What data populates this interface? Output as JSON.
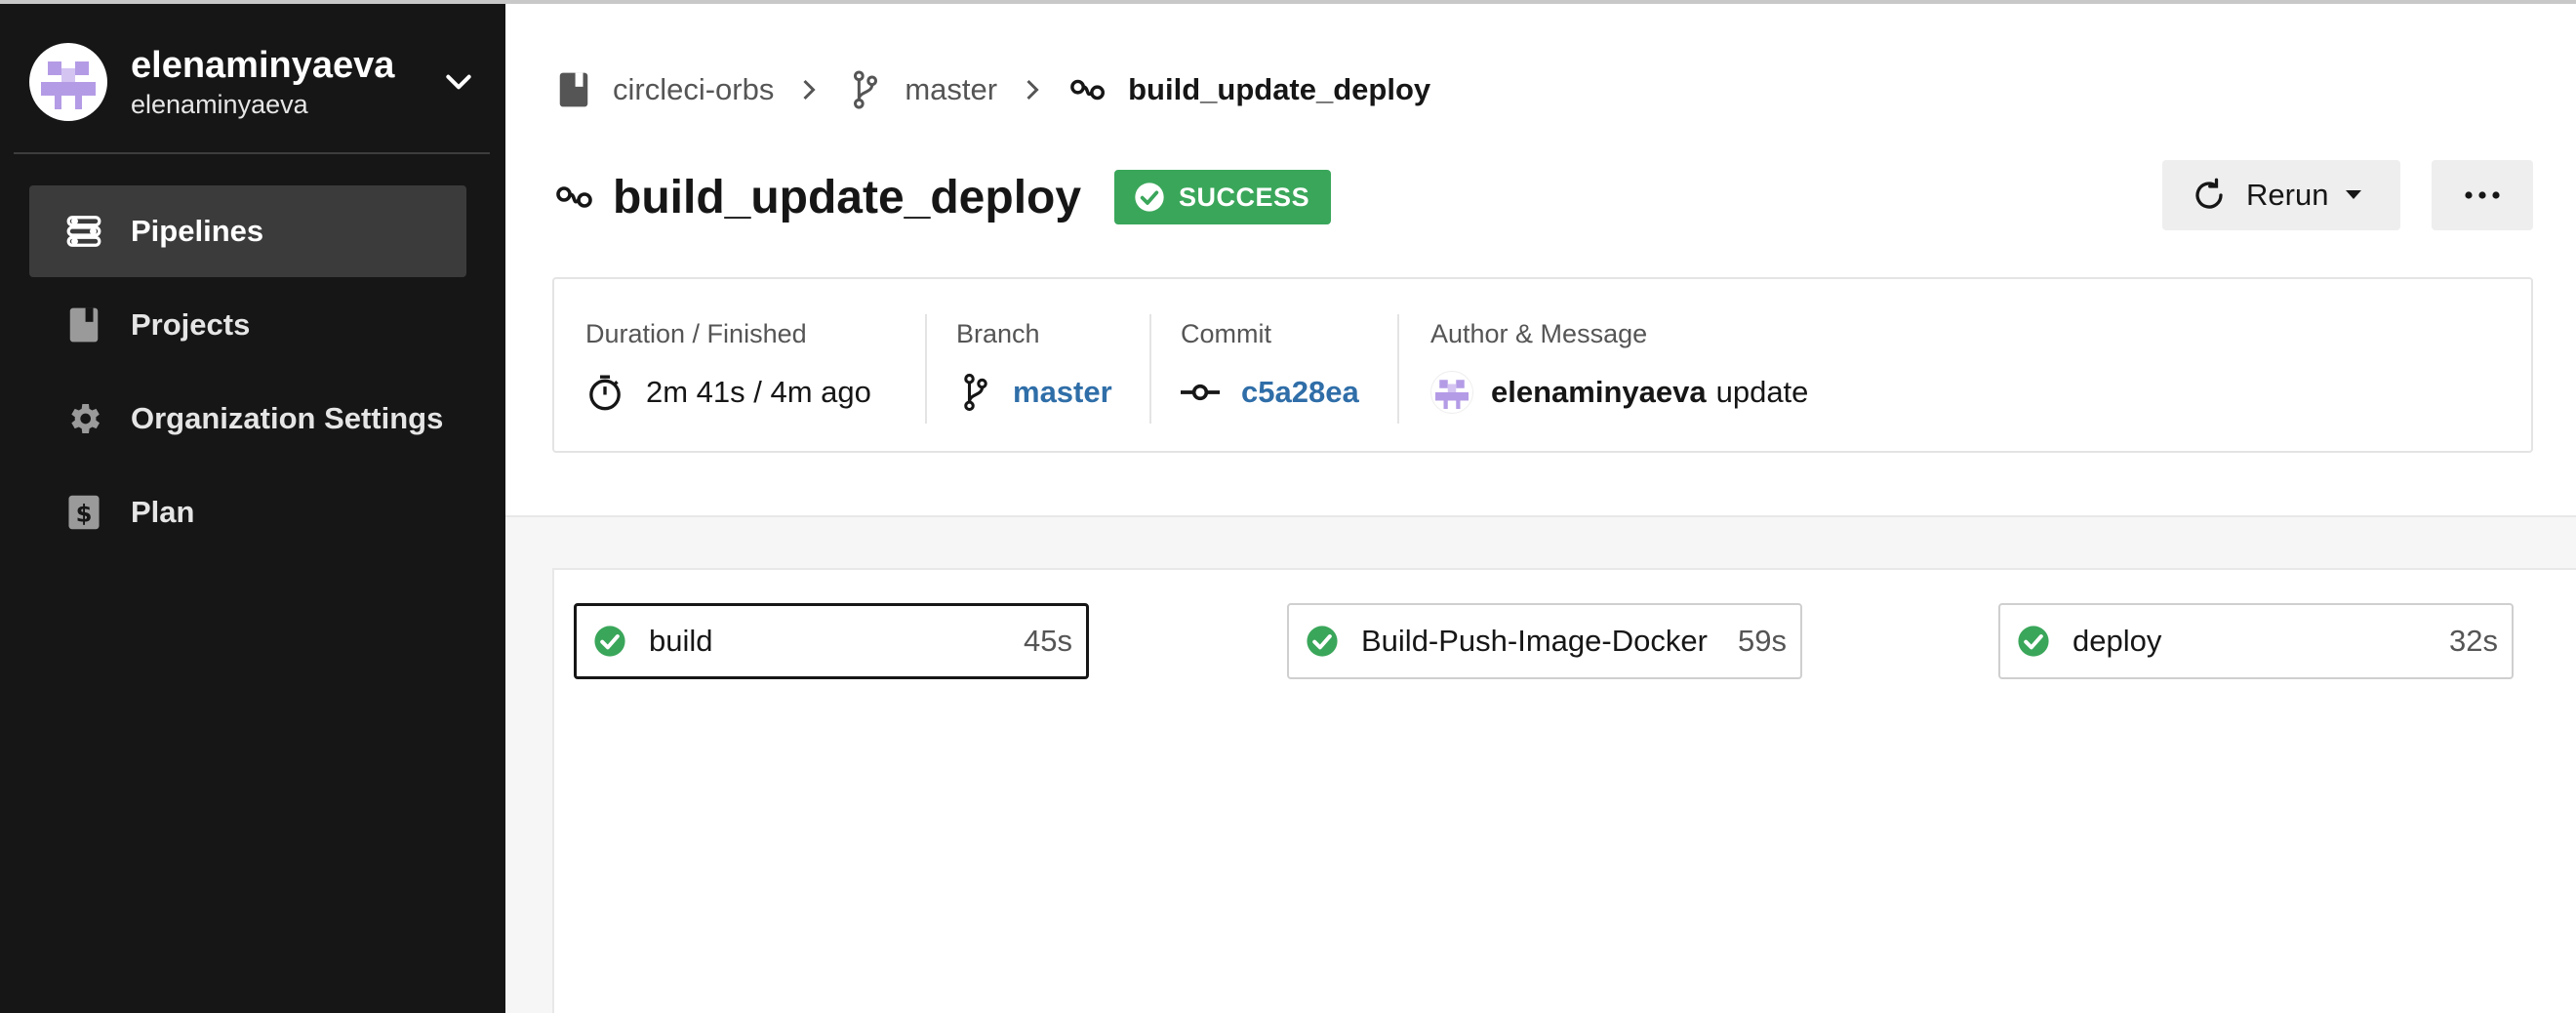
{
  "sidebar": {
    "org_name": "elenaminyaeva",
    "org_user": "elenaminyaeva",
    "items": [
      {
        "label": "Pipelines",
        "icon": "pipelines-icon",
        "active": true
      },
      {
        "label": "Projects",
        "icon": "book-icon",
        "active": false
      },
      {
        "label": "Organization Settings",
        "icon": "gear-icon",
        "active": false
      },
      {
        "label": "Plan",
        "icon": "dollar-icon",
        "active": false
      }
    ]
  },
  "breadcrumb": {
    "project": "circleci-orbs",
    "branch": "master",
    "workflow": "build_update_deploy"
  },
  "header": {
    "title": "build_update_deploy",
    "status": "SUCCESS",
    "rerun_label": "Rerun"
  },
  "summary": {
    "duration_label": "Duration / Finished",
    "duration_value": "2m 41s / 4m ago",
    "branch_label": "Branch",
    "branch_value": "master",
    "commit_label": "Commit",
    "commit_value": "c5a28ea",
    "author_label": "Author & Message",
    "author_name": "elenaminyaeva",
    "message": "update"
  },
  "jobs": [
    {
      "name": "build",
      "duration": "45s",
      "status": "success"
    },
    {
      "name": "Build-Push-Image-Docker",
      "duration": "59s",
      "status": "success"
    },
    {
      "name": "deploy",
      "duration": "32s",
      "status": "success"
    }
  ],
  "colors": {
    "sidebar_bg": "#161616",
    "success": "#3aa65a",
    "link": "#2f6ea8",
    "avatar_purple": "#b49be6"
  }
}
